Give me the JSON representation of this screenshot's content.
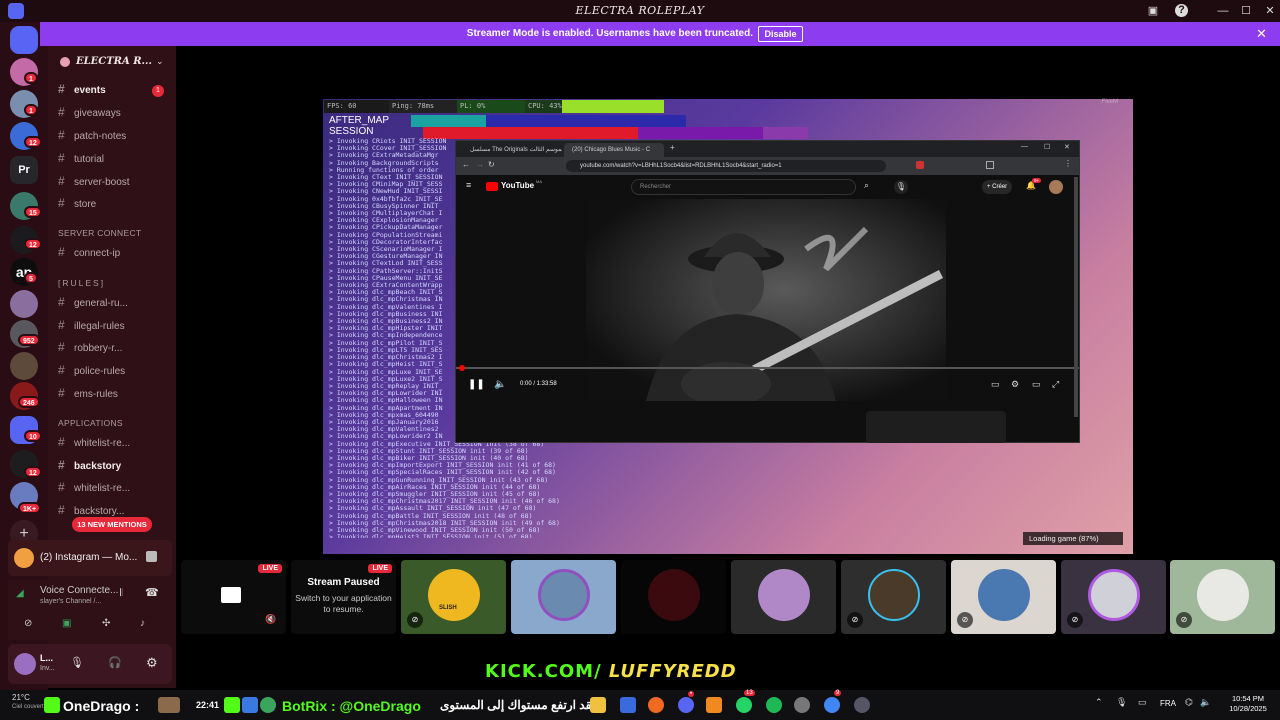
{
  "window": {
    "title": "ELECTRA ROLEPLAY"
  },
  "banner": {
    "text": "Streamer Mode is enabled. Usernames have been truncated.",
    "button": "Disable"
  },
  "rail": {
    "badges": [
      "1",
      "1",
      "12",
      "15",
      "12",
      "5",
      "952",
      "246",
      "10",
      "12",
      "1K+"
    ]
  },
  "server": {
    "name": "ELECTRA R..."
  },
  "channels_top": [
    {
      "label": "events",
      "badge": "1"
    },
    {
      "label": "giveaways"
    },
    {
      "label": "patch-notes"
    },
    {
      "label": "tutorial"
    },
    {
      "label": "server-boost"
    },
    {
      "label": "store"
    }
  ],
  "categories": {
    "server_connect": "SERVER CONNECT",
    "rules": "[RULES]",
    "applications": "APPLICATIONS"
  },
  "channels_connect": [
    {
      "label": "connect-ip"
    }
  ],
  "channels_rules": [
    {
      "label": "general-ru..."
    },
    {
      "label": "illegal-rules"
    },
    {
      "label": "robbery-r..."
    },
    {
      "label": "police-rules"
    },
    {
      "label": "ems-rules"
    }
  ],
  "channels_apps": [
    {
      "label": "whitelist-re..."
    },
    {
      "label": "backstory"
    },
    {
      "label": "whitelist-re..."
    },
    {
      "label": "backstory..."
    }
  ],
  "mentions": "13 NEW MENTIONS",
  "activity": {
    "title": "(2) Instagram — Mo..."
  },
  "voice": {
    "status": "Voice Connecte...",
    "channel": "slayer's Channel /..."
  },
  "user": {
    "name": "L...",
    "status": "Inv..."
  },
  "game": {
    "perf": {
      "fps": "FPS: 60",
      "ping": "Ping: 78ms",
      "pl": "PL: 0%",
      "cpu": "CPU: 43%"
    },
    "aftermap": [
      "AFTER_MAP",
      "SESSION"
    ],
    "loading": "Loading game (87%)",
    "log": [
      "> Invoking CRiots INIT_SESSION",
      "> Invoking CCover INIT_SESSION",
      "> Invoking CExtraMetadataMgr",
      "> Invoking BackgroundScripts",
      "> Running functions of order",
      "> Invoking CText INIT_SESSION",
      "> Invoking CMiniMap INIT_SESS",
      "> Invoking CNewHud INIT_SESSI",
      "> Invoking 0x4bfbfa2c INIT_SE",
      "> Invoking CBusySpinner INIT",
      "> Invoking CMultiplayerChat I",
      "> Invoking CExplosionManager",
      "> Invoking CPickupDataManager",
      "> Invoking CPopulationStreami",
      "> Invoking CDecoratorInterfac",
      "> Invoking CScenarioManager I",
      "> Invoking CGestureManager IN",
      "> Invoking CTextLod INIT_SESS",
      "> Invoking CPathServer::InitS",
      "> Invoking CPauseMenu INIT_SE",
      "> Invoking CExtraContentWrapp",
      "> Invoking dlc_mpBeach INIT_S",
      "> Invoking dlc_mpChristmas IN",
      "> Invoking dlc_mpValentines I",
      "> Invoking dlc_mpBusiness INI",
      "> Invoking dlc_mpBusiness2 IN",
      "> Invoking dlc_mpHipster INIT",
      "> Invoking dlc_mpIndependence",
      "> Invoking dlc_mpPilot INIT_S",
      "> Invoking dlc_mpLTS INIT_SES",
      "> Invoking dlc_mpChristmas2 I",
      "> Invoking dlc_mpHeist INIT_S",
      "> Invoking dlc_mpLuxe INIT_SE",
      "> Invoking dlc_mpLuxe2 INIT_S",
      "> Invoking dlc_mpReplay INIT_",
      "> Invoking dlc_mpLowrider INI",
      "> Invoking dlc_mpHalloween IN",
      "> Invoking dlc_mpApartment IN",
      "> Invoking dlc_mpxmas_604490",
      "> Invoking dlc_mpJanuary2016",
      "> Invoking dlc_mpValentines2",
      "> Invoking dlc_mpLowrider2 IN",
      "> Invoking dlc_mpExecutive INIT_SESSION init (38 of 68)",
      "> Invoking dlc_mpStunt INIT_SESSION init (39 of 68)",
      "> Invoking dlc_mpBiker INIT_SESSION init (40 of 68)",
      "> Invoking dlc_mpImportExport INIT_SESSION init (41 of 68)",
      "> Invoking dlc_mpSpecialRaces INIT_SESSION init (42 of 68)",
      "> Invoking dlc_mpGunRunning INIT_SESSION init (43 of 68)",
      "> Invoking dlc_mpAirRaces INIT_SESSION init (44 of 68)",
      "> Invoking dlc_mpSmuggler INIT_SESSION init (45 of 68)",
      "> Invoking dlc_mpChristmas2017 INIT_SESSION init (46 of 68)",
      "> Invoking dlc_mpAssault INIT_SESSION init (47 of 68)",
      "> Invoking dlc_mpBattle INIT_SESSION init (48 of 68)",
      "> Invoking dlc_mpChristmas2018 INIT_SESSION init (49 of 68)",
      "> Invoking dlc_mpVinewood INIT_SESSION init (50 of 68)",
      "> Invoking dlc_mpHeist3 INIT_SESSION init (51 of 68)"
    ]
  },
  "browser": {
    "tab1": "مسلسل The Originals الموسم الثالث",
    "tab2": "(20) Chicago Blues Music - C",
    "url": "youtube.com/watch?v=LBHhL1Socb4&list=RDLBHhL1Socb4&start_radio=1",
    "yt_logo": "YouTube",
    "yt_region": "MA",
    "search_placeholder": "Rechercher",
    "create": "Créer",
    "notif": "9+",
    "time": "0:00 / 1:33:58"
  },
  "tiles": {
    "live": "LIVE",
    "paused_title": "Stream Paused",
    "paused_sub": "Switch to your application to resume.",
    "avatar_caption": "SLISH"
  },
  "kick": {
    "prefix": "KICK.COM/",
    "name": "LUFFYREDD"
  },
  "taskbar": {
    "weather": "21°C",
    "weather_sub": "Ciel couvert",
    "ticker_1": "OneDrago :",
    "ticker_time": "22:41",
    "ticker_2": "BotRix : @OneDrago",
    "ticker_arabic": "لقد ارتفع مستواك إلى المستوى",
    "app_badge_1": "13",
    "app_badge_2": "9",
    "lang": "FRA",
    "time": "10:54 PM",
    "date": "10/28/2025"
  },
  "colors": {
    "accent": "#8e3cf0",
    "badge": "#e8293a",
    "kick_green": "#53fc18"
  }
}
